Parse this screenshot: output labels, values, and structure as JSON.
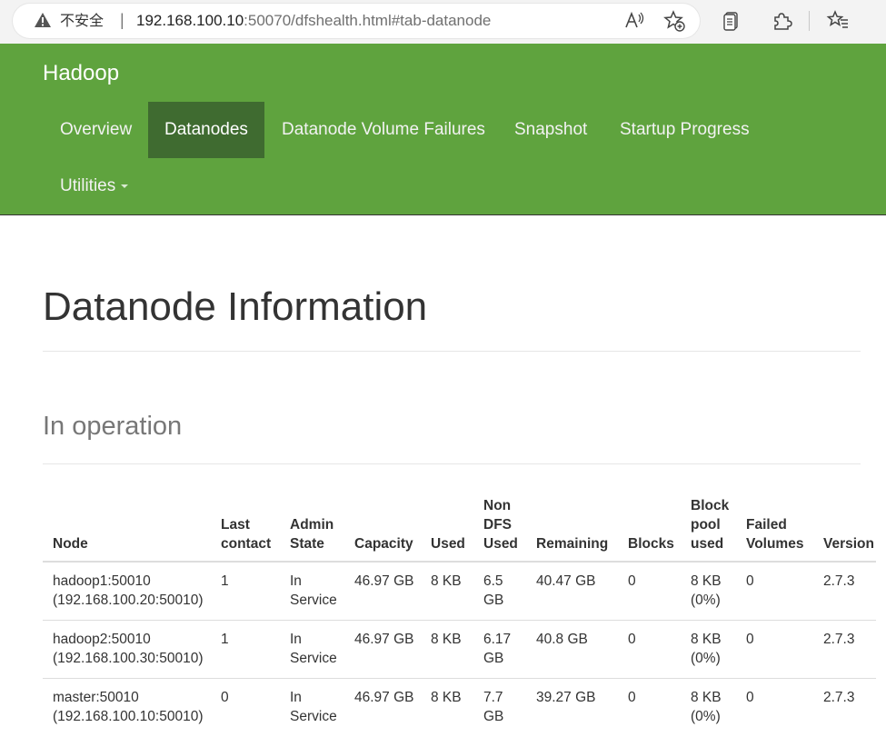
{
  "browser": {
    "insecure_label": "不安全",
    "address_separator": "|",
    "url_host": "192.168.100.10",
    "url_rest": ":50070/dfshealth.html#tab-datanode",
    "icons": [
      "warning-icon",
      "read-aloud-icon",
      "add-favorite-icon",
      "collections-icon",
      "extensions-icon",
      "favorites-icon"
    ]
  },
  "navbar": {
    "brand": "Hadoop",
    "items": [
      {
        "label": "Overview"
      },
      {
        "label": "Datanodes",
        "active": true
      },
      {
        "label": "Datanode Volume Failures"
      },
      {
        "label": "Snapshot"
      },
      {
        "label": "Startup Progress"
      },
      {
        "label": "Utilities"
      }
    ],
    "colors": {
      "background": "#5fa33e",
      "active": "#3f6b30"
    }
  },
  "main": {
    "page_title": "Datanode Information",
    "section_title": "In operation",
    "table": {
      "headers": [
        "Node",
        "Last contact",
        "Admin State",
        "Capacity",
        "Used",
        "Non DFS Used",
        "Remaining",
        "Blocks",
        "Block pool used",
        "Failed Volumes",
        "Version"
      ],
      "rows": [
        {
          "node": "hadoop1:50010 (192.168.100.20:50010)",
          "last_contact": "1",
          "admin_state": "In Service",
          "capacity": "46.97 GB",
          "used": "8 KB",
          "non_dfs_used": "6.5 GB",
          "remaining": "40.47 GB",
          "blocks": "0",
          "block_pool_used": "8 KB (0%)",
          "failed_volumes": "0",
          "version": "2.7.3"
        },
        {
          "node": "hadoop2:50010 (192.168.100.30:50010)",
          "last_contact": "1",
          "admin_state": "In Service",
          "capacity": "46.97 GB",
          "used": "8 KB",
          "non_dfs_used": "6.17 GB",
          "remaining": "40.8 GB",
          "blocks": "0",
          "block_pool_used": "8 KB (0%)",
          "failed_volumes": "0",
          "version": "2.7.3"
        },
        {
          "node": "master:50010 (192.168.100.10:50010)",
          "last_contact": "0",
          "admin_state": "In Service",
          "capacity": "46.97 GB",
          "used": "8 KB",
          "non_dfs_used": "7.7 GB",
          "remaining": "39.27 GB",
          "blocks": "0",
          "block_pool_used": "8 KB (0%)",
          "failed_volumes": "0",
          "version": "2.7.3"
        }
      ]
    }
  }
}
